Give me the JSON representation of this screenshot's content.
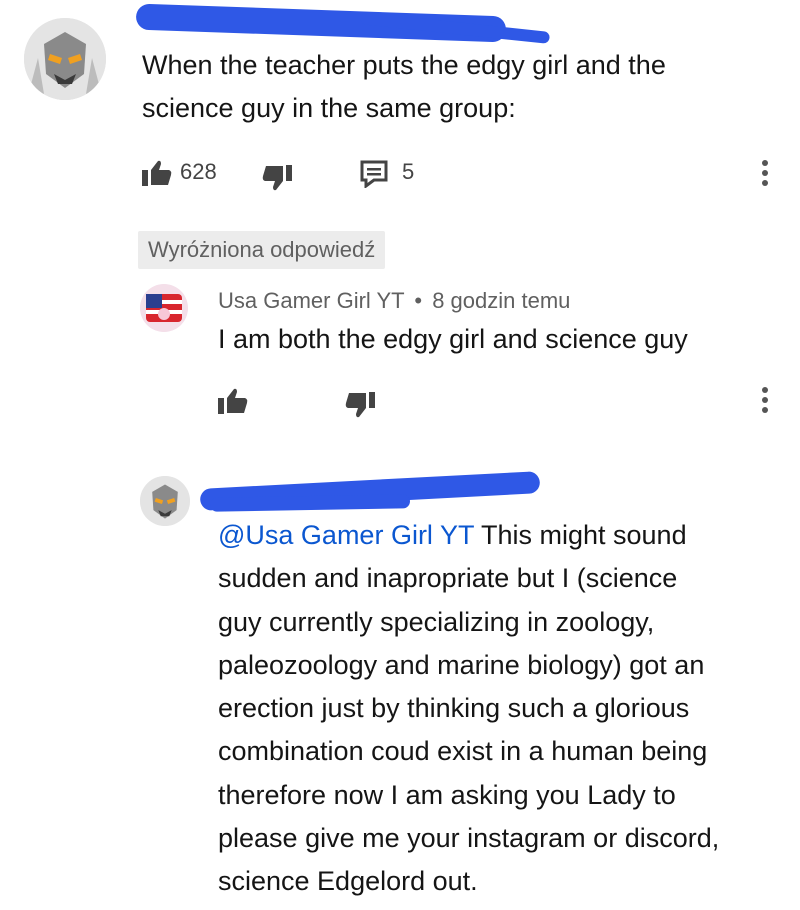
{
  "top_comment": {
    "text_lines": [
      "When the teacher puts the edgy girl and the",
      "science guy in the same group:"
    ],
    "like_count": "628",
    "reply_count": "5",
    "icons": {
      "like": "thumb-up-icon",
      "dislike": "thumb-down-icon",
      "replies": "comment-icon",
      "more": "more-vert-icon"
    }
  },
  "pinned_label": "Wyróżniona odpowiedź",
  "reply_1": {
    "author": "Usa Gamer Girl YT",
    "separator": "•",
    "time": "8 godzin temu",
    "text": "I am both the edgy girl and science guy"
  },
  "reply_2": {
    "mention": "@Usa Gamer Girl YT",
    "lines": [
      " This might sound",
      "sudden and inapropriate but I (science",
      "guy currently specializing in zoology,",
      "paleozoology and marine biology) got an",
      "erection just by thinking such a glorious",
      "combination coud exist in a human being",
      "therefore now I am asking you Lady to",
      "please give me your instagram or discord,",
      "science Edgelord  out."
    ]
  },
  "colors": {
    "redaction": "#2f58e6",
    "mention": "#0b57d0"
  }
}
